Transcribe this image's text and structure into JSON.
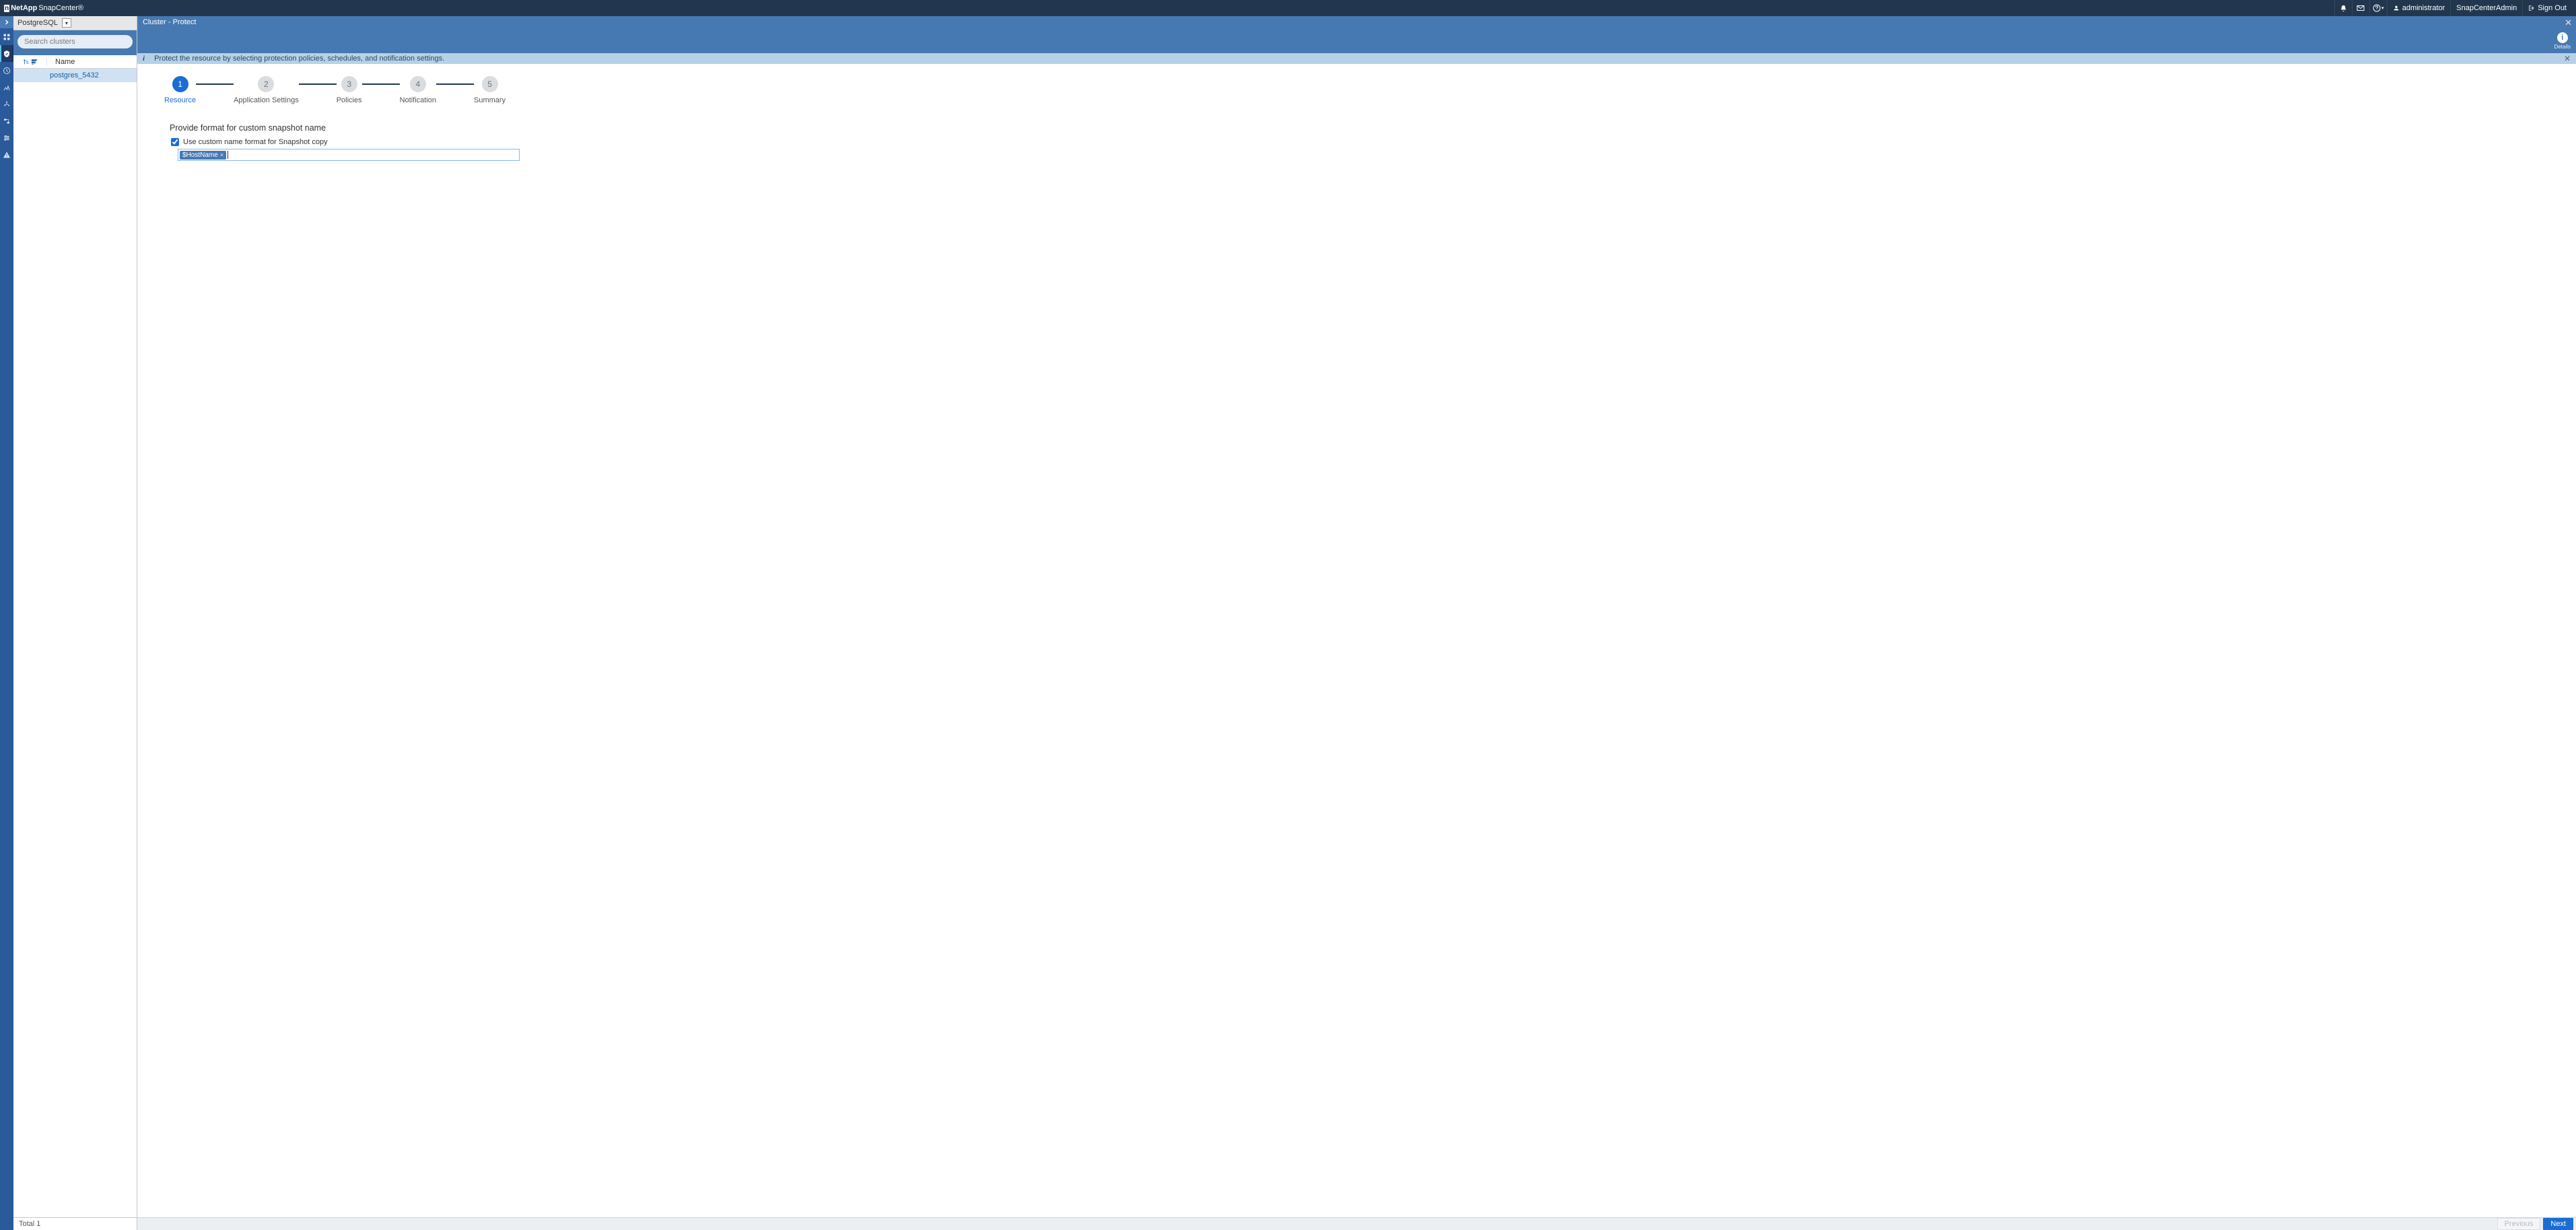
{
  "header": {
    "brand_prefix": "n",
    "brand_word": "NetApp",
    "app_name": "SnapCenter®",
    "user_label": "administrator",
    "admin_label": "SnapCenterAdmin",
    "signout_label": "Sign Out"
  },
  "left": {
    "plugin_label": "PostgreSQL",
    "search_placeholder": "Search clusters",
    "col_name": "Name",
    "rows": [
      {
        "name": "postgres_5432"
      }
    ],
    "footer_total": "Total 1"
  },
  "crumb": {
    "path": "Cluster - Protect",
    "details_label": "Details"
  },
  "info": {
    "text": "Protect the resource by selecting protection policies, schedules, and notification settings."
  },
  "wizard": {
    "steps": [
      {
        "num": "1",
        "label": "Resource"
      },
      {
        "num": "2",
        "label": "Application Settings"
      },
      {
        "num": "3",
        "label": "Policies"
      },
      {
        "num": "4",
        "label": "Notification"
      },
      {
        "num": "5",
        "label": "Summary"
      }
    ]
  },
  "form": {
    "title": "Provide format for custom snapshot name",
    "checkbox_label": "Use custom name format for Snapshot copy",
    "tag_value": "$HostName"
  },
  "footer": {
    "prev": "Previous",
    "next": "Next"
  }
}
